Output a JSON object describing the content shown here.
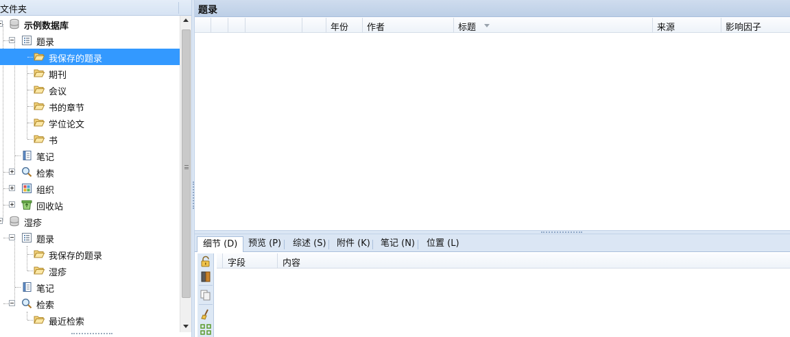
{
  "left_panel": {
    "header": "文件夹",
    "tree": [
      {
        "label": "示例数据库",
        "icon": "database-icon",
        "expander": "minus",
        "bold": true
      },
      {
        "label": "题录",
        "icon": "list-icon",
        "expander": "minus"
      },
      {
        "label": "我保存的题录",
        "icon": "folder-open-icon",
        "selected": true
      },
      {
        "label": "期刊",
        "icon": "folder-open-icon"
      },
      {
        "label": "会议",
        "icon": "folder-open-icon"
      },
      {
        "label": "书的章节",
        "icon": "folder-open-icon"
      },
      {
        "label": "学位论文",
        "icon": "folder-open-icon"
      },
      {
        "label": "书",
        "icon": "folder-open-icon"
      },
      {
        "label": "笔记",
        "icon": "notebook-icon"
      },
      {
        "label": "检索",
        "icon": "magnifier-icon",
        "expander": "plus"
      },
      {
        "label": "组织",
        "icon": "organize-icon",
        "expander": "plus"
      },
      {
        "label": "回收站",
        "icon": "recycle-bin-icon",
        "expander": "plus"
      },
      {
        "label": "湿疹",
        "icon": "database-icon",
        "expander": "minus"
      },
      {
        "label": "题录",
        "icon": "list-icon",
        "expander": "minus"
      },
      {
        "label": "我保存的题录",
        "icon": "folder-open-icon"
      },
      {
        "label": "湿疹",
        "icon": "folder-open-icon"
      },
      {
        "label": "笔记",
        "icon": "notebook-icon"
      },
      {
        "label": "检索",
        "icon": "magnifier-icon",
        "expander": "minus"
      },
      {
        "label": "最近检索",
        "icon": "folder-open-icon"
      }
    ]
  },
  "records_panel": {
    "title": "题录",
    "columns": [
      "",
      "",
      "",
      "",
      "",
      "年份",
      "作者",
      "标题",
      "来源",
      "影响因子"
    ],
    "sorted_column": "标题"
  },
  "tabs": [
    {
      "label": "细节 (D)",
      "active": true
    },
    {
      "label": "预览 (P)"
    },
    {
      "label": "综述 (S)"
    },
    {
      "label": "附件 (K)"
    },
    {
      "label": "笔记 (N)"
    },
    {
      "label": "位置 (L)"
    }
  ],
  "details": {
    "columns": [
      "",
      "字段",
      "内容"
    ],
    "toolbar_icons": [
      "lock-icon",
      "bookmark-icon",
      "copy-icon",
      "brush-icon",
      "grid-icon"
    ]
  },
  "colors": {
    "selection": "#3399ff",
    "header_bg": "#bccfe6",
    "panel_bg": "#dbe6f4"
  }
}
